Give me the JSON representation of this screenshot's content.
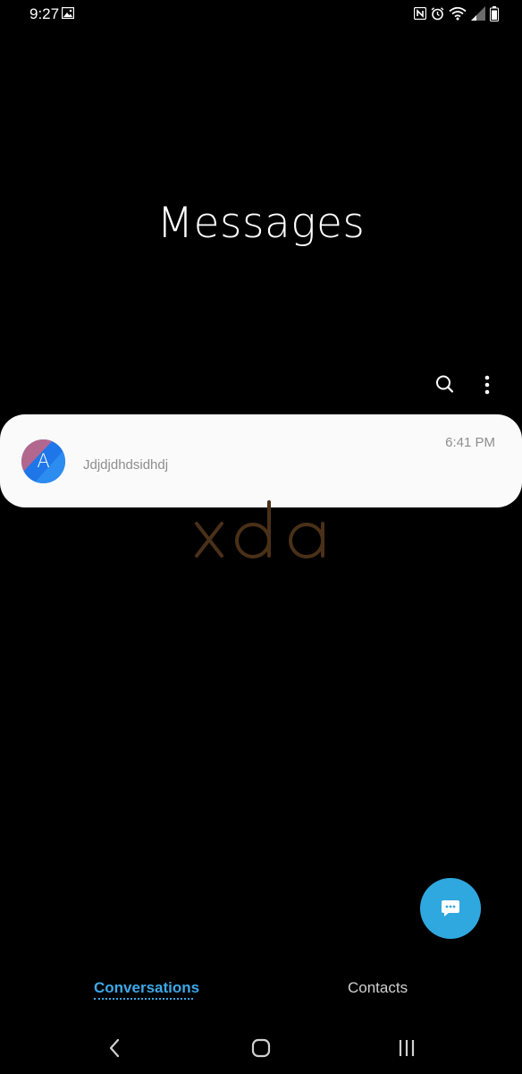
{
  "status_bar": {
    "time": "9:27",
    "icons": [
      "gallery-icon",
      "nfc-icon",
      "alarm-icon",
      "wifi-icon",
      "signal-icon",
      "battery-icon"
    ]
  },
  "header": {
    "title": "Messages"
  },
  "actions": {
    "search_icon": "search-icon",
    "more_icon": "more-vertical-icon"
  },
  "conversations": [
    {
      "avatar_letter": "A",
      "preview": "Jdjdjdhdsidhdj",
      "time": "6:41 PM"
    }
  ],
  "watermark": {
    "text": "xda",
    "color": "#4a3018"
  },
  "fab": {
    "icon": "compose-message-icon",
    "color": "#2fa8e0"
  },
  "tabs": [
    {
      "label": "Conversations",
      "active": true
    },
    {
      "label": "Contacts",
      "active": false
    }
  ],
  "nav_bar": {
    "icons": [
      "back-icon",
      "home-icon",
      "recents-icon"
    ]
  },
  "colors": {
    "background": "#000000",
    "accent": "#3ea8e8",
    "card": "#fafafa"
  }
}
